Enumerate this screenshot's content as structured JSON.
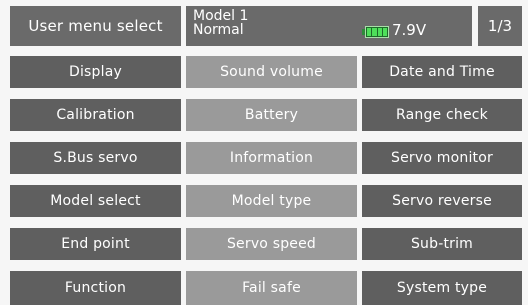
{
  "header": {
    "title": "User menu select",
    "model_name": "Model 1",
    "condition": "Normal",
    "battery_icon": "battery-icon",
    "voltage": "7.9V",
    "page": "1/3"
  },
  "menu": [
    [
      "Display",
      "Sound volume",
      "Date and Time"
    ],
    [
      "Calibration",
      "Battery",
      "Range check"
    ],
    [
      "S.Bus servo",
      "Information",
      "Servo monitor"
    ],
    [
      "Model select",
      "Model type",
      "Servo reverse"
    ],
    [
      "End point",
      "Servo speed",
      "Sub-trim"
    ],
    [
      "Function",
      "Fail safe",
      "System type"
    ]
  ],
  "colors": {
    "header_bg": "#6a6a6a",
    "button_dark": "#5f5f5f",
    "button_light": "#9a9a9a",
    "battery_green": "#4ee05a"
  }
}
